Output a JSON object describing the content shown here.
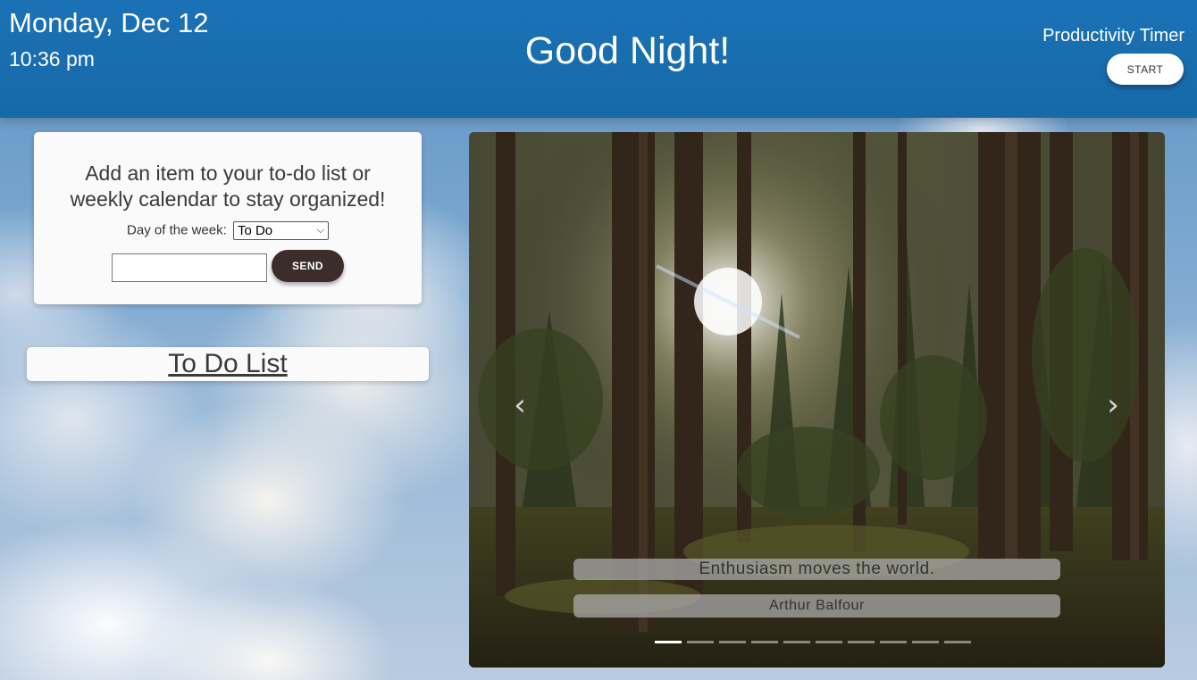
{
  "header": {
    "date": "Monday, Dec 12",
    "time": "10:36 pm",
    "greeting": "Good Night!",
    "timer_title": "Productivity Timer",
    "start_label": "START"
  },
  "form": {
    "heading_line1": "Add an item to your to-do list or",
    "heading_line2": "weekly calendar to stay organized!",
    "day_label": "Day of the week:",
    "day_selected": "To Do",
    "input_value": "",
    "send_label": "SEND"
  },
  "todo": {
    "title": "To Do List"
  },
  "carousel": {
    "quote": "Enthusiasm moves the world.",
    "author": "Arthur Balfour",
    "slide_count": 10,
    "active_index": 0,
    "prev_icon": "chevron-left-icon",
    "next_icon": "chevron-right-icon"
  },
  "colors": {
    "header_bg": "#1a72b5",
    "send_button": "#3a2d2c",
    "card_bg": "#fafafa"
  }
}
